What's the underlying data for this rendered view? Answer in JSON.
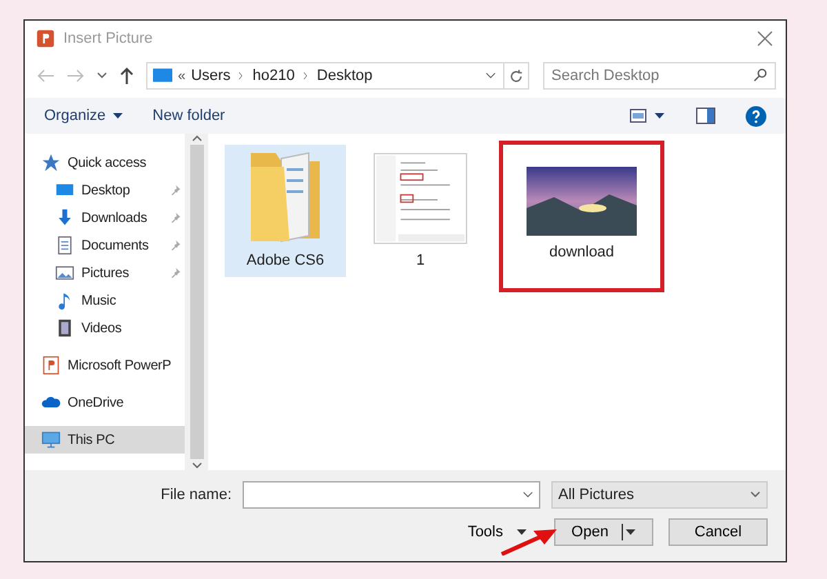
{
  "window": {
    "title": "Insert Picture"
  },
  "address": {
    "overflow": "«",
    "path": [
      "Users",
      "ho210",
      "Desktop"
    ]
  },
  "search": {
    "placeholder": "Search Desktop"
  },
  "toolbar": {
    "organize": "Organize",
    "new_folder": "New folder"
  },
  "sidebar": {
    "items": [
      {
        "label": "Quick access",
        "kind": "star",
        "selected": false,
        "children": [
          {
            "label": "Desktop",
            "kind": "desktop",
            "pinned": true,
            "selected": false
          },
          {
            "label": "Downloads",
            "kind": "download",
            "pinned": true,
            "selected": false
          },
          {
            "label": "Documents",
            "kind": "document",
            "pinned": true,
            "selected": false
          },
          {
            "label": "Pictures",
            "kind": "picture",
            "pinned": true,
            "selected": false
          },
          {
            "label": "Music",
            "kind": "music",
            "pinned": false,
            "selected": false
          },
          {
            "label": "Videos",
            "kind": "video",
            "pinned": false,
            "selected": false
          }
        ]
      },
      {
        "label": "Microsoft PowerP",
        "kind": "powerpoint",
        "selected": false
      },
      {
        "label": "OneDrive",
        "kind": "cloud",
        "selected": false
      },
      {
        "label": "This PC",
        "kind": "pc",
        "selected": true
      }
    ]
  },
  "files": [
    {
      "name": "Adobe CS6",
      "kind": "folder",
      "selected": true,
      "marked": false
    },
    {
      "name": "1",
      "kind": "screenshot",
      "selected": false,
      "marked": false
    },
    {
      "name": "download",
      "kind": "photo",
      "selected": false,
      "marked": true
    }
  ],
  "footer": {
    "file_name_label": "File name:",
    "filter": "All Pictures",
    "tools": "Tools",
    "buttons": [
      {
        "label": "Open",
        "kind": "split"
      },
      {
        "label": "Cancel",
        "kind": "plain"
      }
    ],
    "pointer_arrow": true
  }
}
